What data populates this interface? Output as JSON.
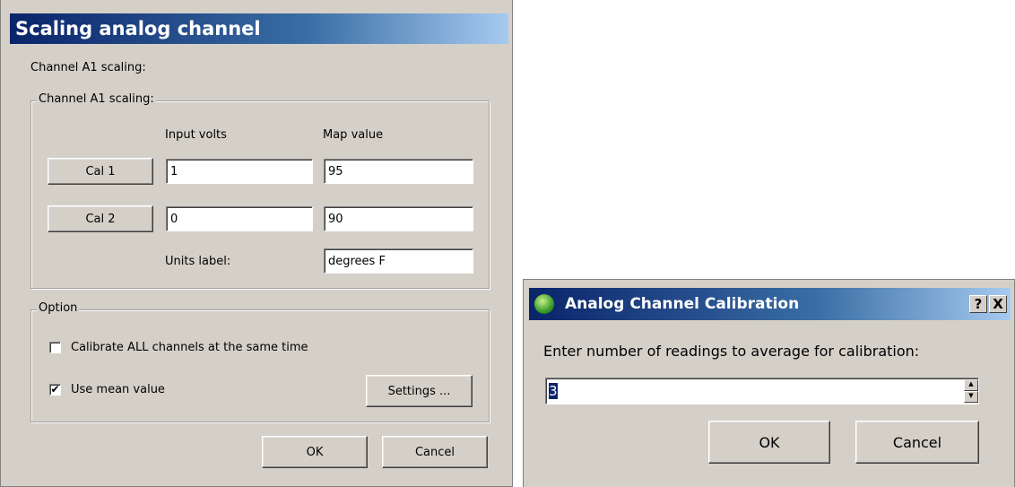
{
  "scaling": {
    "title": "Scaling analog channel",
    "heading": "Channel A1 scaling:",
    "group_label": "Channel A1 scaling:",
    "col_input": "Input volts",
    "col_map": "Map value",
    "cal1": {
      "label": "Cal 1",
      "input": "1",
      "map": "95"
    },
    "cal2": {
      "label": "Cal 2",
      "input": "0",
      "map": "90"
    },
    "units_label": "Units label:",
    "units_value": "degrees F",
    "option_group": "Option",
    "calibrate_all": {
      "label": "Calibrate ALL channels at the same time",
      "checked": false
    },
    "use_mean": {
      "label": "Use mean value",
      "checked": true
    },
    "settings": "Settings ...",
    "ok": "OK",
    "cancel": "Cancel"
  },
  "calibration": {
    "title": "Analog Channel Calibration",
    "help": "?",
    "close": "X",
    "prompt": "Enter number of readings to average for calibration:",
    "readings": "3",
    "ok": "OK",
    "cancel": "Cancel",
    "icon": "globe-icon"
  }
}
